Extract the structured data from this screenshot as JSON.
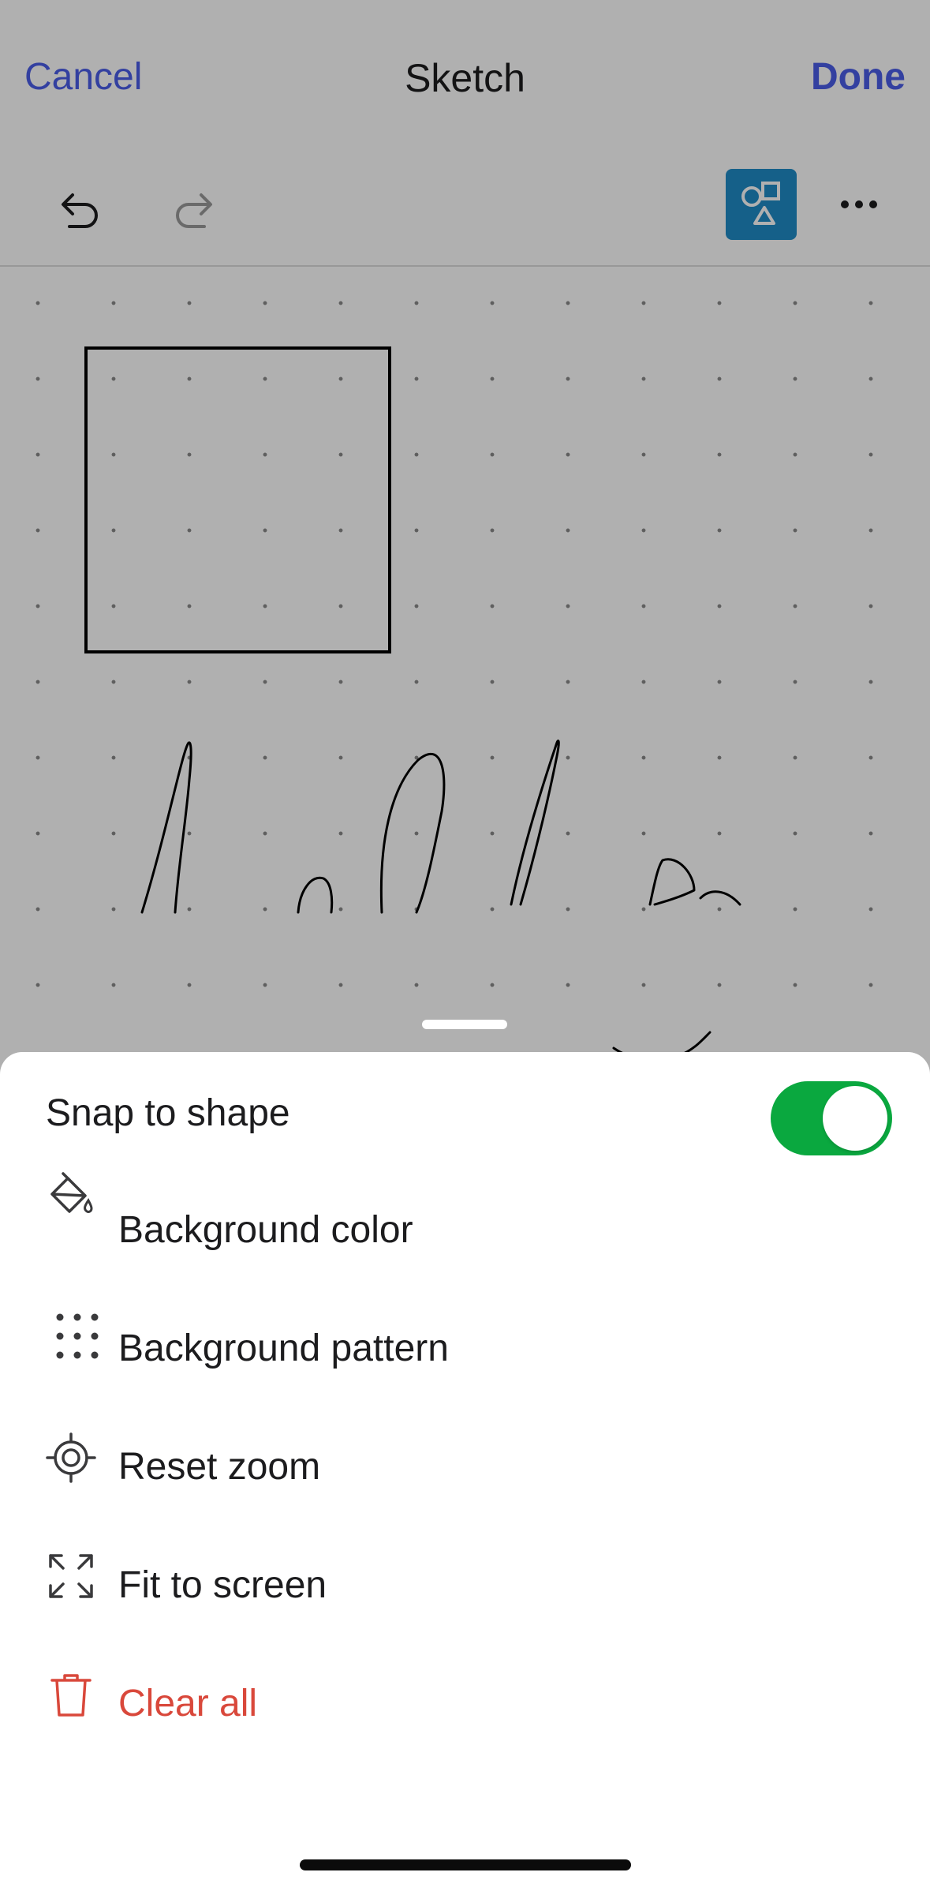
{
  "nav": {
    "cancel_label": "Cancel",
    "title": "Sketch",
    "done_label": "Done"
  },
  "toolbar": {
    "undo_icon": "undo-icon",
    "redo_icon": "redo-icon",
    "redo_enabled": false,
    "shapes_icon": "shapes-icon",
    "shapes_active": true,
    "more_icon": "more-icon"
  },
  "canvas": {
    "background_pattern": "dots",
    "drawn_shapes": [
      "square",
      "freehand-strokes"
    ]
  },
  "sheet": {
    "snap_to_shape": {
      "label": "Snap to shape",
      "enabled": true
    },
    "items": [
      {
        "label": "Background color",
        "icon": "paint-bucket-icon",
        "danger": false
      },
      {
        "label": "Background pattern",
        "icon": "dot-grid-icon",
        "danger": false
      },
      {
        "label": "Reset zoom",
        "icon": "target-icon",
        "danger": false
      },
      {
        "label": "Fit to screen",
        "icon": "expand-icon",
        "danger": false
      },
      {
        "label": "Clear all",
        "icon": "trash-icon",
        "danger": true
      }
    ]
  },
  "colors": {
    "accent": "#4a5de8",
    "toggle_on": "#0aa83f",
    "shapes_button": "#1f8bc7",
    "danger": "#d9483b"
  }
}
